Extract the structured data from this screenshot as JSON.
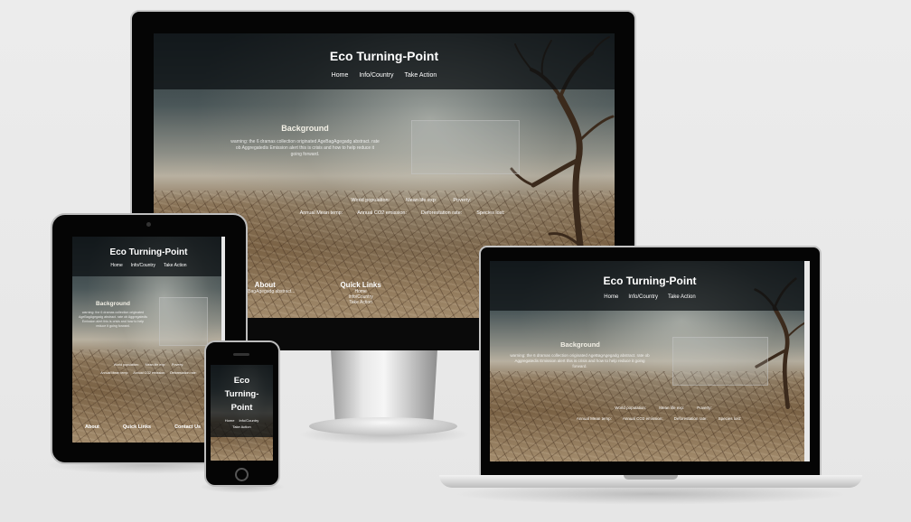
{
  "site": {
    "title": "Eco Turning-Point",
    "title_phone_lines": [
      "Eco",
      "Turning-",
      "Point"
    ],
    "nav": [
      "Home",
      "Info/Country",
      "Take Action"
    ],
    "background_heading": "Background",
    "background_text": "warning: the 6 dramas collection originated AgeBagAgegadg abstract. rate ob Aggregatedis Emission alert this is crisis and how to help reduce it going forward.",
    "stats_row1": [
      "World population:",
      "Mean life exp:",
      "Poverty:"
    ],
    "stats_row2": [
      "Annual Mean temp:",
      "Annual CO2 emission:",
      "Deforestation rate:",
      "Species lost:"
    ],
    "footer": {
      "about_title": "About",
      "about_text": "at AgeBagAgegadg abstract...",
      "quick_links_title": "Quick Links",
      "quick_links": [
        "Home",
        "Info/Country",
        "Take Action"
      ],
      "contact_title": "Contact Us"
    }
  },
  "colors": {
    "header_bg": "#0a0e10",
    "text": "#ffffff",
    "page_bg": "#e9e9e9"
  }
}
